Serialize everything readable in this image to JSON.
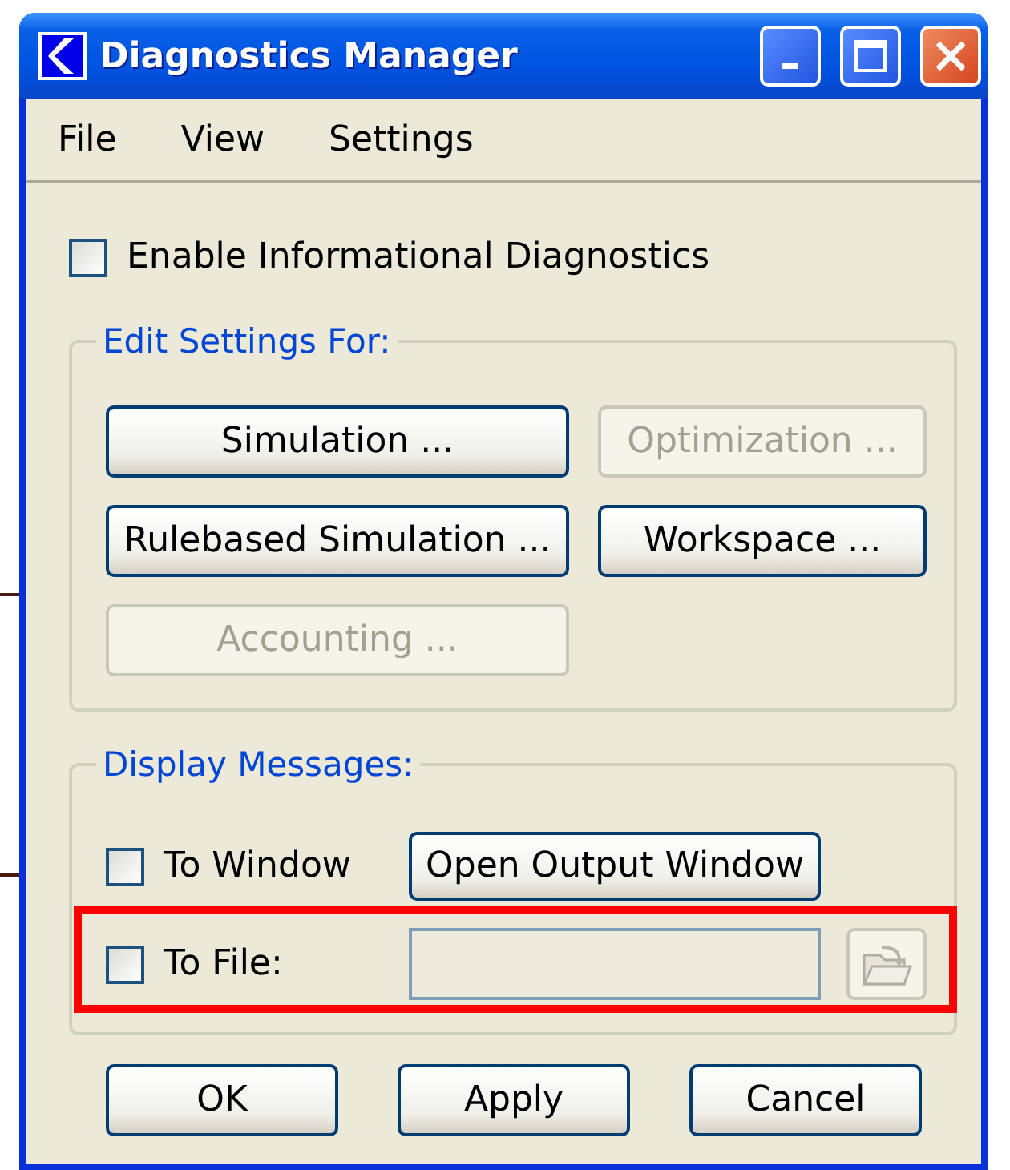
{
  "window": {
    "title": "Diagnostics Manager"
  },
  "menu": [
    {
      "label": "File"
    },
    {
      "label": "View"
    },
    {
      "label": "Settings"
    }
  ],
  "enable_informational": {
    "label": "Enable Informational Diagnostics",
    "checked": false
  },
  "edit_settings": {
    "title": "Edit Settings For:",
    "buttons": [
      {
        "label": "Simulation ...",
        "disabled": false
      },
      {
        "label": "Optimization ...",
        "disabled": true
      },
      {
        "label": "Rulebased Simulation ...",
        "disabled": false
      },
      {
        "label": "Workspace ...",
        "disabled": false
      },
      {
        "label": "Accounting ...",
        "disabled": true
      }
    ]
  },
  "display_messages": {
    "title": "Display Messages:",
    "to_window": {
      "label": "To Window",
      "checked": false,
      "button": "Open Output Window"
    },
    "to_file": {
      "label": "To File:",
      "checked": false,
      "field_disabled": true,
      "browse_disabled": true,
      "highlighted": true
    }
  },
  "buttons": [
    {
      "label": "OK"
    },
    {
      "label": "Apply"
    },
    {
      "label": "Cancel"
    }
  ]
}
